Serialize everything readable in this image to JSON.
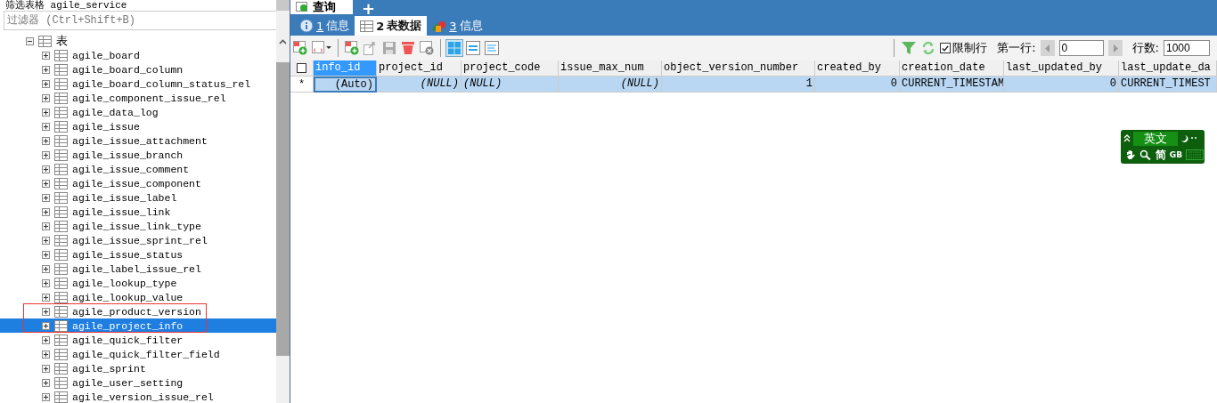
{
  "sidebar": {
    "heading": "筛选表格 agile_service",
    "filter": {
      "placeholder": "过滤器 (Ctrl+Shift+B)"
    },
    "tree": [
      {
        "label": "表",
        "expanded": true,
        "selected": false,
        "children": [
          {
            "label": "agile_board",
            "expanded": false,
            "selected": false
          },
          {
            "label": "agile_board_column",
            "expanded": false,
            "selected": false
          },
          {
            "label": "agile_board_column_status_rel",
            "expanded": false,
            "selected": false
          },
          {
            "label": "agile_component_issue_rel",
            "expanded": false,
            "selected": false
          },
          {
            "label": "agile_data_log",
            "expanded": false,
            "selected": false
          },
          {
            "label": "agile_issue",
            "expanded": false,
            "selected": false
          },
          {
            "label": "agile_issue_attachment",
            "expanded": false,
            "selected": false
          },
          {
            "label": "agile_issue_branch",
            "expanded": false,
            "selected": false
          },
          {
            "label": "agile_issue_comment",
            "expanded": false,
            "selected": false
          },
          {
            "label": "agile_issue_component",
            "expanded": false,
            "selected": false
          },
          {
            "label": "agile_issue_label",
            "expanded": false,
            "selected": false
          },
          {
            "label": "agile_issue_link",
            "expanded": false,
            "selected": false
          },
          {
            "label": "agile_issue_link_type",
            "expanded": false,
            "selected": false
          },
          {
            "label": "agile_issue_sprint_rel",
            "expanded": false,
            "selected": false
          },
          {
            "label": "agile_issue_status",
            "expanded": false,
            "selected": false
          },
          {
            "label": "agile_label_issue_rel",
            "expanded": false,
            "selected": false
          },
          {
            "label": "agile_lookup_type",
            "expanded": false,
            "selected": false
          },
          {
            "label": "agile_lookup_value",
            "expanded": false,
            "selected": false
          },
          {
            "label": "agile_product_version",
            "expanded": false,
            "selected": false
          },
          {
            "label": "agile_project_info",
            "expanded": false,
            "selected": true
          },
          {
            "label": "agile_quick_filter",
            "expanded": false,
            "selected": false
          },
          {
            "label": "agile_quick_filter_field",
            "expanded": false,
            "selected": false
          },
          {
            "label": "agile_sprint",
            "expanded": false,
            "selected": false
          },
          {
            "label": "agile_user_setting",
            "expanded": false,
            "selected": false
          },
          {
            "label": "agile_version_issue_rel",
            "expanded": false,
            "selected": false
          }
        ]
      }
    ]
  },
  "editor_tabs": [
    {
      "label": "查询",
      "kind": "query"
    },
    {
      "label": "+",
      "kind": "add"
    }
  ],
  "tabs": [
    {
      "key": "1",
      "label": "信息",
      "kind": "info",
      "selected": false
    },
    {
      "key": "2",
      "label": "表数据",
      "kind": "table",
      "selected": true
    },
    {
      "key": "3",
      "label": "信息",
      "kind": "shapes",
      "selected": false
    }
  ],
  "toolbar": {
    "limit": {
      "label": "限制行",
      "checked": true
    },
    "first_row": {
      "label": "第一行:",
      "value": "0"
    },
    "rows": {
      "label": "行数:",
      "value": "1000"
    }
  },
  "grid": {
    "select_all": {
      "checked": false
    },
    "columns": [
      {
        "name": "info_id",
        "kind": "number",
        "selected": true
      },
      {
        "name": "project_id",
        "kind": "number",
        "selected": false
      },
      {
        "name": "project_code",
        "kind": "text",
        "selected": false
      },
      {
        "name": "issue_max_num",
        "kind": "number",
        "selected": false
      },
      {
        "name": "object_version_number",
        "kind": "number",
        "selected": false
      },
      {
        "name": "created_by",
        "kind": "number",
        "selected": false
      },
      {
        "name": "creation_date",
        "kind": "text",
        "selected": false
      },
      {
        "name": "last_updated_by",
        "kind": "number",
        "selected": false
      },
      {
        "name": "last_update_da",
        "kind": "text",
        "selected": false
      }
    ],
    "rows": [
      {
        "marker": "*",
        "selected": true,
        "cells": [
          {
            "text": "(Auto)",
            "kind": "auto"
          },
          {
            "text": "(NULL)",
            "kind": "null"
          },
          {
            "text": "(NULL)",
            "kind": "null"
          },
          {
            "text": "(NULL)",
            "kind": "null"
          },
          {
            "text": "1",
            "kind": "value"
          },
          {
            "text": "0",
            "kind": "value"
          },
          {
            "text": "CURRENT_TIMESTAM",
            "kind": "value"
          },
          {
            "text": "0",
            "kind": "value"
          },
          {
            "text": "CURRENT_TIMEST",
            "kind": "value"
          }
        ]
      }
    ]
  },
  "ime": {
    "mode": "英文",
    "script": "简",
    "charset": "GB"
  }
}
